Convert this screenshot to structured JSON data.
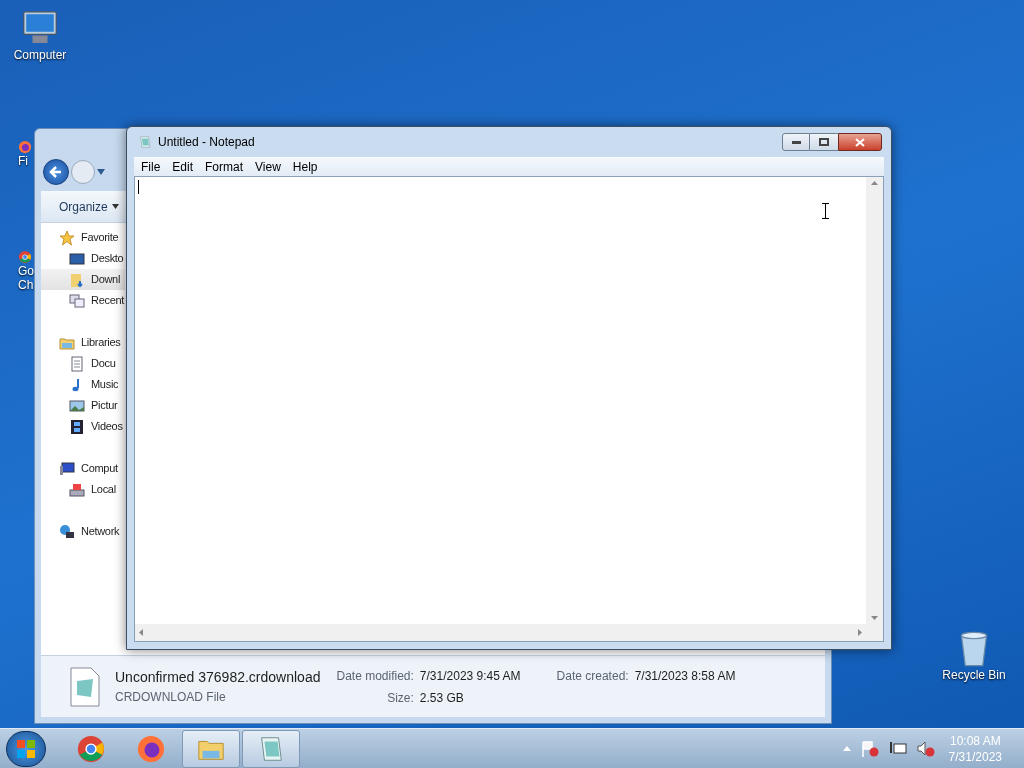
{
  "desktop_icons": [
    {
      "kind": "computer",
      "lines": [
        "Computer"
      ]
    },
    {
      "kind": "firefox",
      "lines": [
        "Fi"
      ]
    },
    {
      "kind": "chrome",
      "lines": [
        "Go",
        "Ch"
      ]
    },
    {
      "kind": "recycle",
      "lines": [
        "Recycle Bin"
      ]
    }
  ],
  "explorer": {
    "toolbar": {
      "organize": "Organize"
    },
    "nav": [
      {
        "kind": "favorites",
        "label": "Favorite",
        "selected": false
      },
      {
        "kind": "desktop",
        "label": "Deskto",
        "selected": false
      },
      {
        "kind": "downloads",
        "label": "Downl",
        "selected": true
      },
      {
        "kind": "recent",
        "label": "Recent",
        "selected": false
      },
      {
        "kind": "libraries",
        "label": "Libraries",
        "selected": false
      },
      {
        "kind": "documents",
        "label": "Docu",
        "selected": false
      },
      {
        "kind": "music",
        "label": "Music",
        "selected": false
      },
      {
        "kind": "pictures",
        "label": "Pictur",
        "selected": false
      },
      {
        "kind": "videos",
        "label": "Videos",
        "selected": false
      },
      {
        "kind": "computer",
        "label": "Comput",
        "selected": false
      },
      {
        "kind": "disk",
        "label": "Local",
        "selected": false
      },
      {
        "kind": "network",
        "label": "Network",
        "selected": false
      }
    ],
    "details": {
      "name": "Unconfirmed 376982.crdownload",
      "type": "CRDOWNLOAD File",
      "fields": [
        {
          "label": "Date modified:",
          "value": "7/31/2023 9:45 AM"
        },
        {
          "label": "Date created:",
          "value": "7/31/2023 8:58 AM"
        },
        {
          "label": "Size:",
          "value": "2.53 GB"
        }
      ]
    }
  },
  "notepad": {
    "title": "Untitled - Notepad",
    "menu": [
      "File",
      "Edit",
      "Format",
      "View",
      "Help"
    ]
  },
  "taskbar": {
    "items": [
      {
        "kind": "chrome",
        "active": false
      },
      {
        "kind": "firefox",
        "active": false
      },
      {
        "kind": "explorer",
        "active": true
      },
      {
        "kind": "notepad",
        "active": true
      }
    ],
    "time": "10:08 AM",
    "date": "7/31/2023"
  }
}
